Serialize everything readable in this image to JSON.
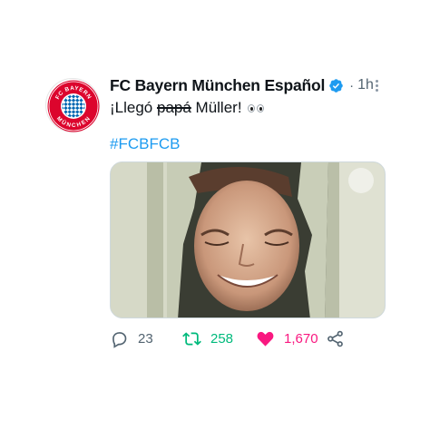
{
  "tweet": {
    "display_name": "FC Bayern München Español",
    "separator": "·",
    "time": "1h",
    "text_prefix": "¡Llegó ",
    "text_strike": "papá",
    "text_suffix": " Müller!",
    "emoji": "eyes",
    "hashtag": "#FCBFCB",
    "avatar_badge": {
      "top_text": "FC BAYERN",
      "bottom_text": "MÜNCHEN",
      "colors": {
        "red": "#dc052d",
        "blue": "#0066b2"
      }
    }
  },
  "actions": {
    "reply_count": "23",
    "retweet_count": "258",
    "like_count": "1,670",
    "icons": [
      "reply-icon",
      "retweet-icon",
      "heart-icon",
      "share-icon"
    ]
  },
  "colors": {
    "link": "#1d9bf0",
    "verified": "#1d9bf0",
    "retweet": "#00ba7c",
    "like": "#f91880",
    "secondary": "#536471"
  }
}
